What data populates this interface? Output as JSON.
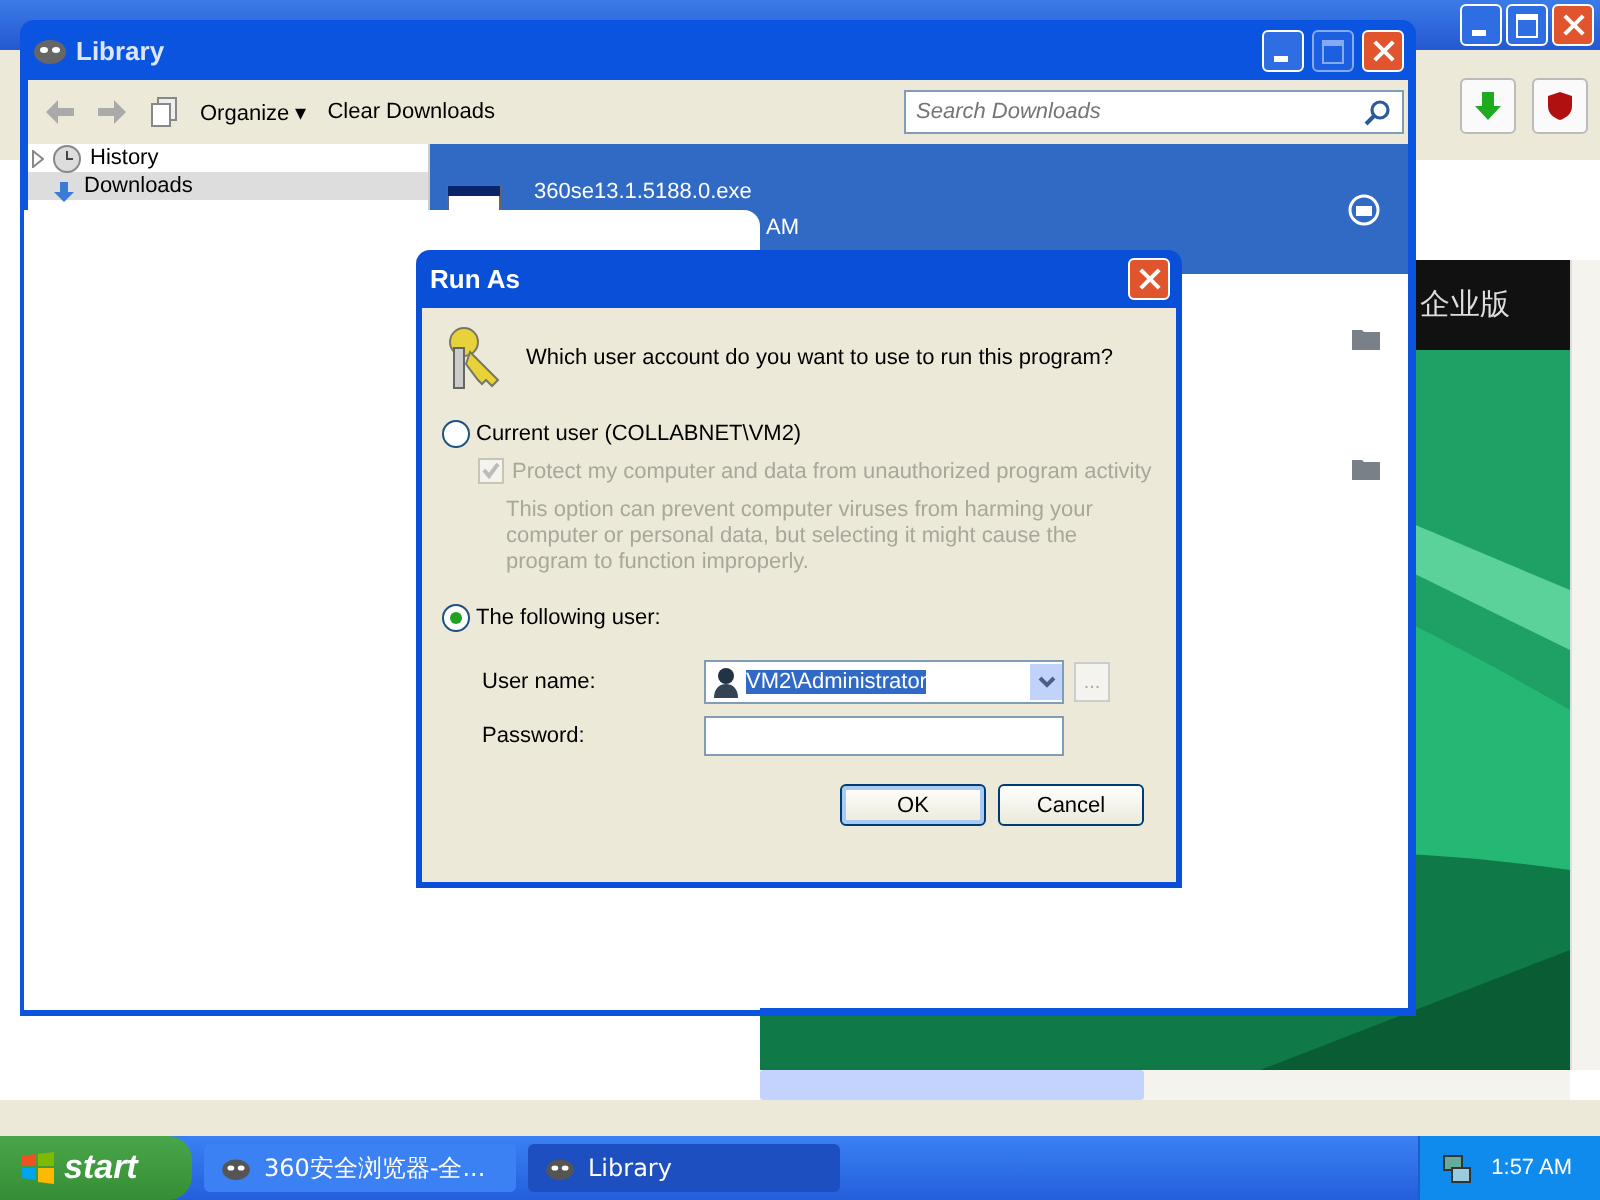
{
  "browser": {
    "banner_text": "企业版"
  },
  "library": {
    "title": "Library",
    "toolbar": {
      "organize": "Organize",
      "organize_caret": "▾",
      "clear": "Clear Downloads"
    },
    "search": {
      "placeholder": "Search Downloads"
    },
    "sidebar": [
      {
        "label": "History",
        "selected": false,
        "kind": "history"
      },
      {
        "label": "Downloads",
        "selected": true,
        "kind": "downloads"
      }
    ],
    "downloads": [
      {
        "name": "360se13.1.5188.0.exe",
        "time": "AM",
        "selected": true
      },
      {
        "selected": false
      },
      {
        "selected": false
      }
    ]
  },
  "dialog": {
    "title": "Run As",
    "question": "Which user account do you want to use to run this program?",
    "options": [
      {
        "label": "Current user (COLLABNET\\VM2)",
        "selected": false
      },
      {
        "label": "The following user:",
        "selected": true
      }
    ],
    "protect": {
      "label": "Protect my computer and data from unauthorized program activity",
      "checked": true,
      "disabled": true
    },
    "description": "This option can prevent computer viruses from harming your computer or personal data, but selecting it might cause the program to function improperly.",
    "username_label": "User name:",
    "username": "VM2\\Administrator",
    "browse": "...",
    "password_label": "Password:",
    "buttons": [
      {
        "label": "OK",
        "default": true
      },
      {
        "label": "Cancel",
        "default": false
      }
    ]
  },
  "taskbar": {
    "start": "start",
    "tasks": [
      {
        "label": "360安全浏览器-全...",
        "selected": false
      },
      {
        "label": "Library",
        "selected": true
      }
    ],
    "clock": "1:57 AM"
  }
}
